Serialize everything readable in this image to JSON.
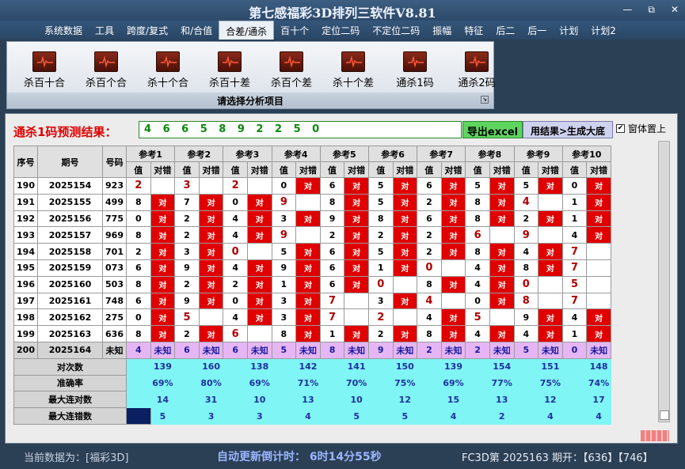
{
  "app": {
    "title": "第七感福彩3D排列三软件V8.81"
  },
  "window_buttons": [
    "—",
    "⧉",
    "✕"
  ],
  "menu": [
    "系统数据",
    "工具",
    "跨度/复式",
    "和/合值",
    "合差/通杀",
    "百十个",
    "定位二码",
    "不定位二码",
    "振幅",
    "特征",
    "后二",
    "后一",
    "计划",
    "计划2"
  ],
  "menu_active": 4,
  "ribbon": {
    "buttons": [
      "杀百十合",
      "杀百个合",
      "杀十个合",
      "杀百十差",
      "杀百个差",
      "杀十个差",
      "通杀1码",
      "通杀2码"
    ],
    "footer": "请选择分析项目"
  },
  "prediction": {
    "label": "通杀1码预测结果：",
    "value": "4 6 6 5 8 9 2 2 5 0",
    "export_label": "导出excel",
    "generate_label": "用结果>生成大底",
    "topmost_label": "窗体置上",
    "topmost_checked": true
  },
  "table": {
    "headers": {
      "seq": "序号",
      "period": "期号",
      "code": "号码",
      "refs": [
        "参考1",
        "参考2",
        "参考3",
        "参考4",
        "参考5",
        "参考6",
        "参考7",
        "参考8",
        "参考9",
        "参考10"
      ],
      "value": "值",
      "result": "对错"
    },
    "rows": [
      {
        "seq": "190",
        "period": "2025154",
        "code": "923",
        "cells": [
          [
            "2",
            ""
          ],
          [
            "3",
            ""
          ],
          [
            "2",
            ""
          ],
          [
            "0",
            "对"
          ],
          [
            "6",
            "对"
          ],
          [
            "5",
            "对"
          ],
          [
            "6",
            "对"
          ],
          [
            "5",
            "对"
          ],
          [
            "5",
            "对"
          ],
          [
            "0",
            "对"
          ]
        ]
      },
      {
        "seq": "191",
        "period": "2025155",
        "code": "499",
        "cells": [
          [
            "8",
            "对"
          ],
          [
            "7",
            "对"
          ],
          [
            "0",
            "对"
          ],
          [
            "9",
            ""
          ],
          [
            "8",
            "对"
          ],
          [
            "5",
            "对"
          ],
          [
            "2",
            "对"
          ],
          [
            "8",
            "对"
          ],
          [
            "4",
            ""
          ],
          [
            "1",
            "对"
          ]
        ]
      },
      {
        "seq": "192",
        "period": "2025156",
        "code": "775",
        "cells": [
          [
            "0",
            "对"
          ],
          [
            "2",
            "对"
          ],
          [
            "4",
            "对"
          ],
          [
            "3",
            "对"
          ],
          [
            "9",
            "对"
          ],
          [
            "8",
            "对"
          ],
          [
            "6",
            "对"
          ],
          [
            "8",
            "对"
          ],
          [
            "2",
            "对"
          ],
          [
            "1",
            "对"
          ]
        ]
      },
      {
        "seq": "193",
        "period": "2025157",
        "code": "969",
        "cells": [
          [
            "8",
            "对"
          ],
          [
            "2",
            "对"
          ],
          [
            "4",
            "对"
          ],
          [
            "9",
            ""
          ],
          [
            "2",
            "对"
          ],
          [
            "2",
            "对"
          ],
          [
            "2",
            "对"
          ],
          [
            "6",
            ""
          ],
          [
            "9",
            ""
          ],
          [
            "4",
            "对"
          ]
        ]
      },
      {
        "seq": "194",
        "period": "2025158",
        "code": "701",
        "cells": [
          [
            "2",
            "对"
          ],
          [
            "3",
            "对"
          ],
          [
            "0",
            ""
          ],
          [
            "5",
            "对"
          ],
          [
            "6",
            "对"
          ],
          [
            "5",
            "对"
          ],
          [
            "2",
            "对"
          ],
          [
            "8",
            "对"
          ],
          [
            "4",
            "对"
          ],
          [
            "7",
            ""
          ]
        ]
      },
      {
        "seq": "195",
        "period": "2025159",
        "code": "073",
        "cells": [
          [
            "6",
            "对"
          ],
          [
            "9",
            "对"
          ],
          [
            "4",
            "对"
          ],
          [
            "9",
            "对"
          ],
          [
            "6",
            "对"
          ],
          [
            "1",
            "对"
          ],
          [
            "0",
            ""
          ],
          [
            "4",
            "对"
          ],
          [
            "8",
            "对"
          ],
          [
            "7",
            ""
          ]
        ]
      },
      {
        "seq": "196",
        "period": "2025160",
        "code": "503",
        "cells": [
          [
            "8",
            "对"
          ],
          [
            "2",
            "对"
          ],
          [
            "2",
            "对"
          ],
          [
            "1",
            "对"
          ],
          [
            "6",
            "对"
          ],
          [
            "0",
            ""
          ],
          [
            "8",
            "对"
          ],
          [
            "4",
            "对"
          ],
          [
            "0",
            ""
          ],
          [
            "5",
            ""
          ]
        ]
      },
      {
        "seq": "197",
        "period": "2025161",
        "code": "748",
        "cells": [
          [
            "6",
            "对"
          ],
          [
            "9",
            "对"
          ],
          [
            "0",
            "对"
          ],
          [
            "3",
            "对"
          ],
          [
            "7",
            ""
          ],
          [
            "3",
            "对"
          ],
          [
            "4",
            ""
          ],
          [
            "0",
            "对"
          ],
          [
            "8",
            ""
          ],
          [
            "7",
            ""
          ]
        ]
      },
      {
        "seq": "198",
        "period": "2025162",
        "code": "275",
        "cells": [
          [
            "0",
            "对"
          ],
          [
            "5",
            ""
          ],
          [
            "4",
            "对"
          ],
          [
            "3",
            "对"
          ],
          [
            "7",
            ""
          ],
          [
            "2",
            ""
          ],
          [
            "4",
            "对"
          ],
          [
            "5",
            ""
          ],
          [
            "9",
            "对"
          ],
          [
            "4",
            "对"
          ]
        ]
      },
      {
        "seq": "199",
        "period": "2025163",
        "code": "636",
        "cells": [
          [
            "8",
            "对"
          ],
          [
            "2",
            "对"
          ],
          [
            "6",
            ""
          ],
          [
            "8",
            "对"
          ],
          [
            "1",
            "对"
          ],
          [
            "2",
            "对"
          ],
          [
            "8",
            "对"
          ],
          [
            "4",
            "对"
          ],
          [
            "4",
            "对"
          ],
          [
            "1",
            "对"
          ]
        ]
      }
    ],
    "pred_row": {
      "seq": "200",
      "period": "2025164",
      "code": "未知",
      "values": [
        "4",
        "6",
        "6",
        "5",
        "8",
        "9",
        "2",
        "2",
        "5",
        "0"
      ],
      "unknown": "未知"
    },
    "stats": {
      "hits_label": "对次数",
      "hits": [
        "139",
        "160",
        "138",
        "142",
        "141",
        "150",
        "139",
        "154",
        "151",
        "148"
      ],
      "acc_label": "准确率",
      "acc": [
        "69%",
        "80%",
        "69%",
        "71%",
        "70%",
        "75%",
        "69%",
        "77%",
        "75%",
        "74%"
      ],
      "maxhit_label": "最大连对数",
      "maxhit": [
        "14",
        "31",
        "10",
        "13",
        "10",
        "12",
        "15",
        "13",
        "12",
        "17"
      ],
      "maxmiss_label": "最大连错数",
      "maxmiss": [
        "5",
        "3",
        "3",
        "4",
        "5",
        "5",
        "4",
        "2",
        "4",
        "4"
      ]
    }
  },
  "statusbar": {
    "current": "当前数据为：[福彩3D]",
    "countdown": "自动更新倒计时：  6时14分55秒",
    "draw": "FC3D第 2025163 期开：【636】【746】"
  },
  "colors": {
    "hit": "#e00000",
    "prediction_row": "#e6b6f4",
    "stats": "#7ff5f5",
    "predict_text": "#0a8a0a"
  }
}
